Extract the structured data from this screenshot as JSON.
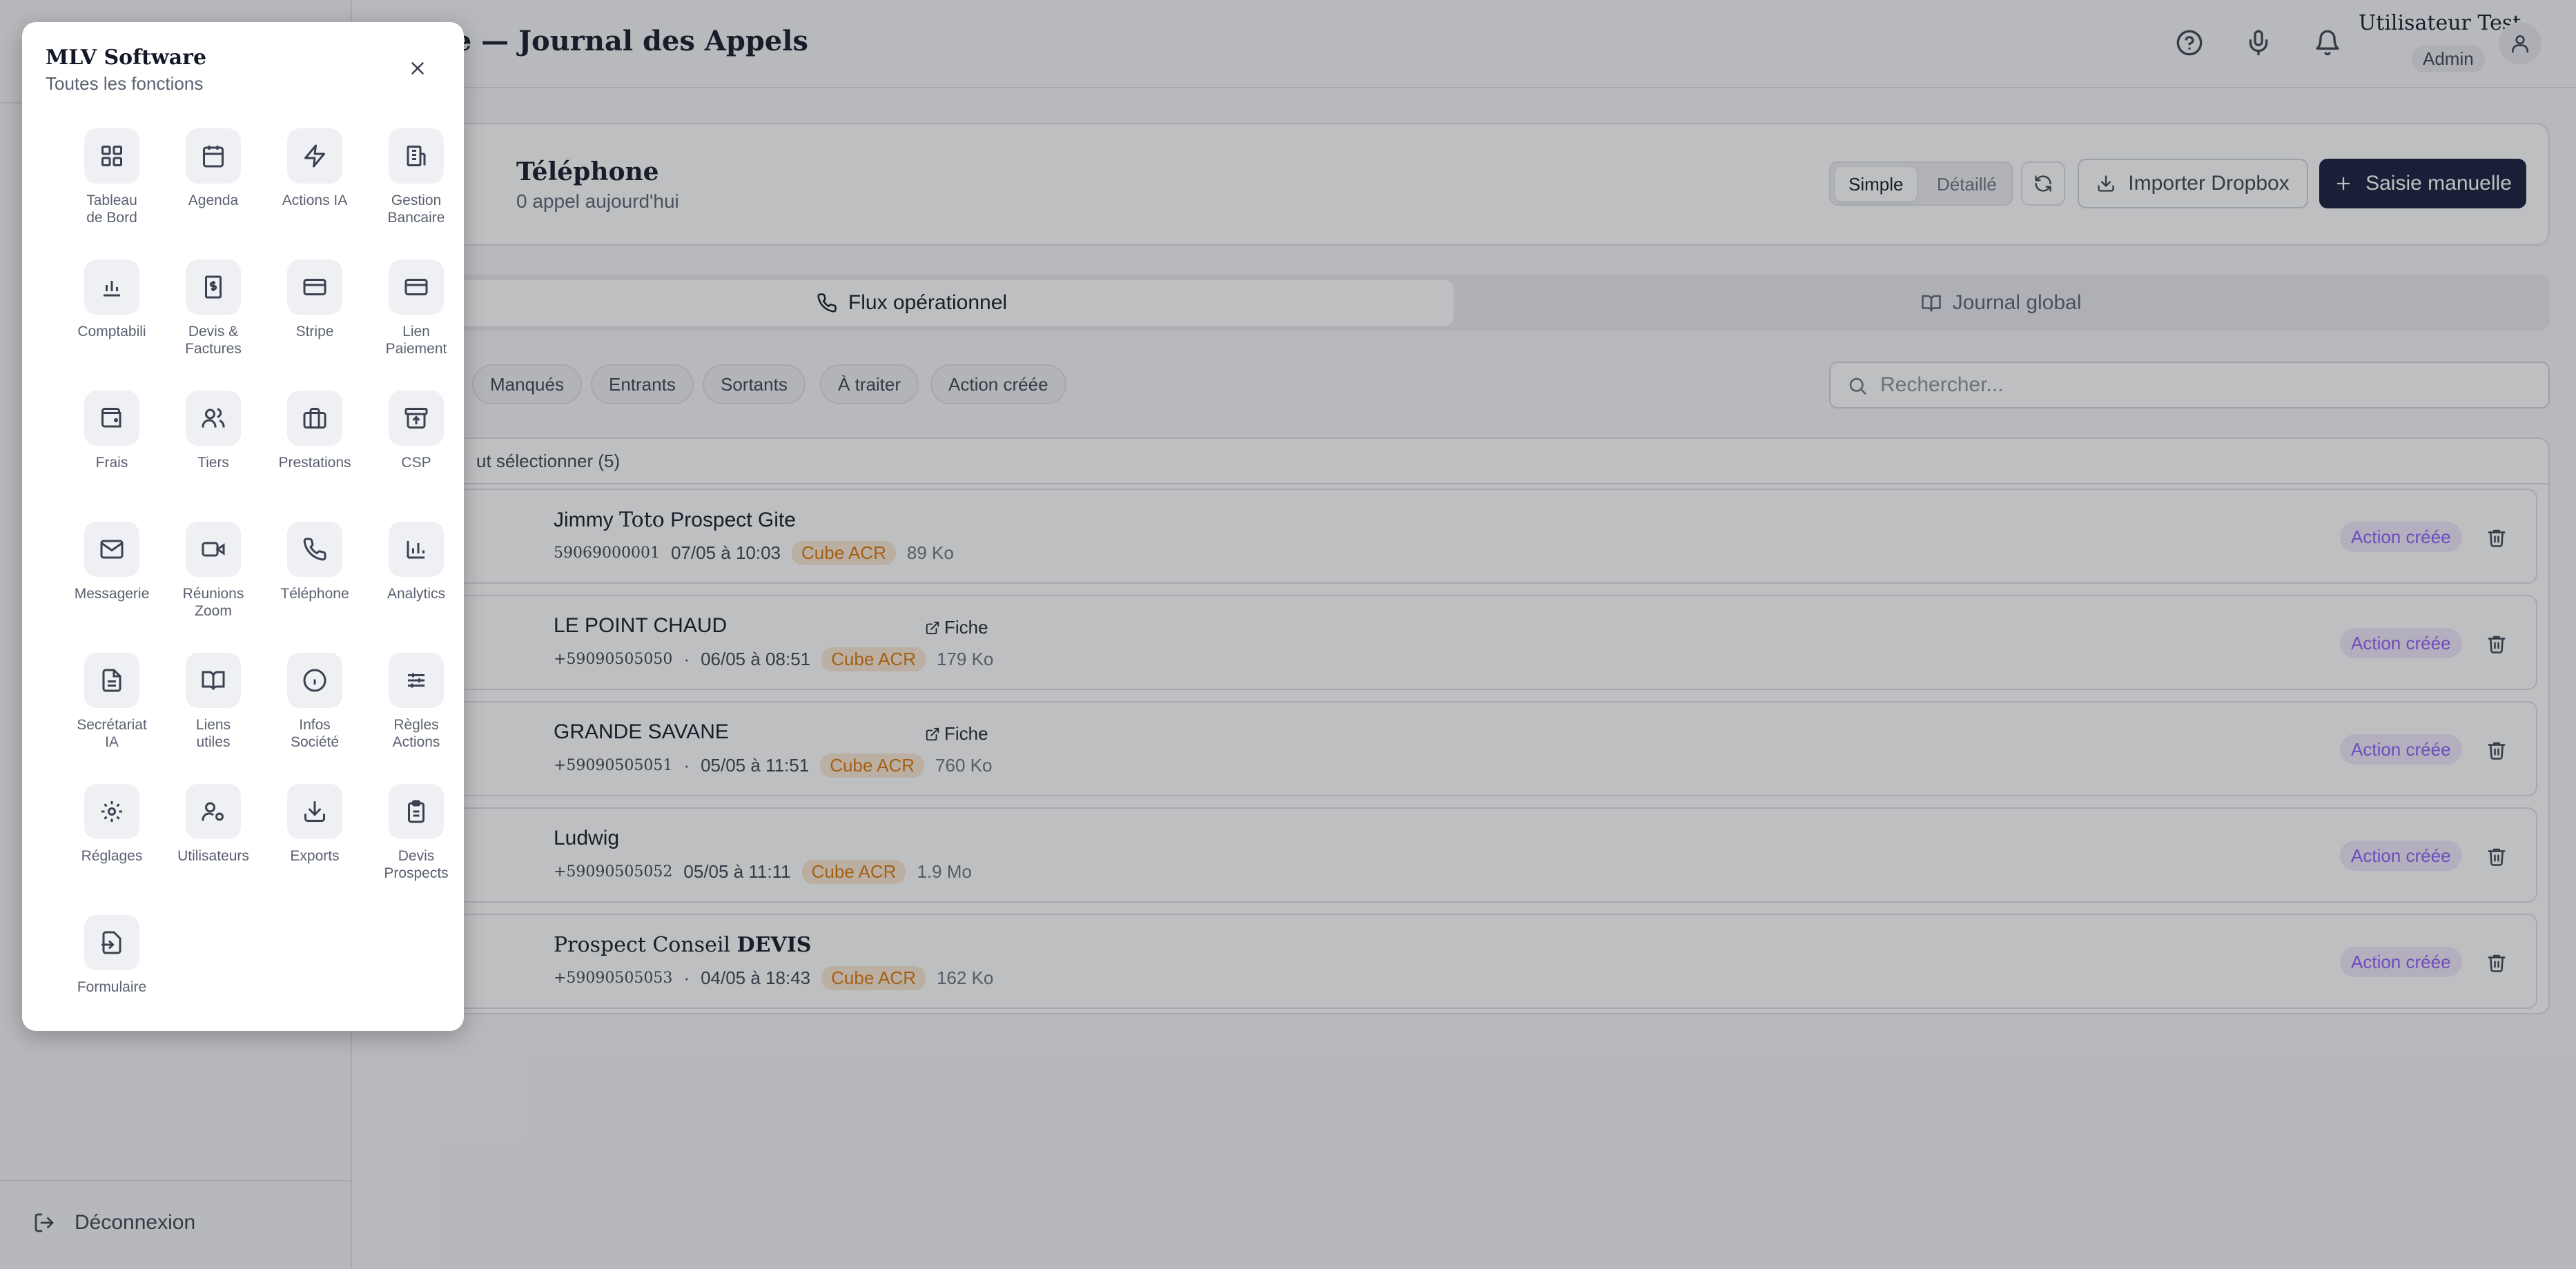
{
  "sidebar": {
    "logout_label": "Déconnexion"
  },
  "header": {
    "title": "one — Journal des Appels",
    "user_name": "Utilisateur Test",
    "user_role": "Admin"
  },
  "card": {
    "title": "Téléphone",
    "subtitle": "0 appel aujourd'hui",
    "view_simple": "Simple",
    "view_detailed": "Détaillé",
    "import_label": "Importer Dropbox",
    "manual_label": "Saisie manuelle"
  },
  "tabs": [
    {
      "label": "Flux opérationnel",
      "active": true
    },
    {
      "label": "Journal global",
      "active": false
    }
  ],
  "filters": [
    "Manqués",
    "Entrants",
    "Sortants",
    "À traiter",
    "Action créée"
  ],
  "search": {
    "placeholder": "Rechercher..."
  },
  "select_all": "ut sélectionner (5)",
  "calls": [
    {
      "name_a": "Jimmy",
      "name_b": "Toto",
      "name_c": "Prospect Gite",
      "number": "59069000001",
      "sep": "",
      "date": "07/05 à 10:03",
      "tag": "Cube ACR",
      "size": "89 Ko",
      "fiche": "",
      "status": "Action créée",
      "direction": "out"
    },
    {
      "name_a": "LE POINT CHAUD",
      "name_b": "",
      "name_c": "",
      "number": "+59090505050",
      "sep": "·",
      "date": "06/05 à 08:51",
      "tag": "Cube ACR",
      "size": "179 Ko",
      "fiche": "Fiche",
      "status": "Action créée",
      "direction": "in"
    },
    {
      "name_a": "GRANDE SAVANE",
      "name_b": "",
      "name_c": "",
      "number": "+59090505051",
      "sep": "·",
      "date": "05/05 à 11:51",
      "tag": "Cube ACR",
      "size": "760 Ko",
      "fiche": "Fiche",
      "status": "Action créée",
      "direction": "out"
    },
    {
      "name_a": "Ludwig",
      "name_b": "",
      "name_c": "",
      "number": "+59090505052",
      "sep": "",
      "date": "05/05 à 11:11",
      "tag": "Cube ACR",
      "size": "1.9 Mo",
      "fiche": "",
      "status": "Action créée",
      "direction": "in"
    },
    {
      "name_a": "",
      "name_b": "Prospect Conseil",
      "name_c": "DEVIS",
      "number": "+59090505053",
      "sep": "·",
      "date": "04/05 à 18:43",
      "tag": "Cube ACR",
      "size": "162 Ko",
      "fiche": "",
      "status": "Action créée",
      "direction": "out"
    }
  ],
  "panel": {
    "title": "MLV Software",
    "subtitle": "Toutes les fonctions",
    "items": [
      {
        "label": "Tableau\nde Bord",
        "icon": "dashboard-icon"
      },
      {
        "label": "Agenda",
        "icon": "calendar-icon"
      },
      {
        "label": "Actions IA",
        "icon": "lightning-icon"
      },
      {
        "label": "Gestion\nBancaire",
        "icon": "bank-icon"
      },
      {
        "label": "Comptabili",
        "icon": "bar-chart-icon"
      },
      {
        "label": "Devis &\nFactures",
        "icon": "invoice-icon"
      },
      {
        "label": "Stripe",
        "icon": "credit-card-icon"
      },
      {
        "label": "Lien\nPaiement",
        "icon": "payment-link-icon"
      },
      {
        "label": "Frais",
        "icon": "wallet-icon"
      },
      {
        "label": "Tiers",
        "icon": "users-icon"
      },
      {
        "label": "Prestations",
        "icon": "briefcase-icon"
      },
      {
        "label": "CSP",
        "icon": "archive-icon"
      },
      {
        "label": "Messagerie",
        "icon": "mail-icon"
      },
      {
        "label": "Réunions\nZoom",
        "icon": "video-icon"
      },
      {
        "label": "Téléphone",
        "icon": "phone-icon"
      },
      {
        "label": "Analytics",
        "icon": "analytics-icon"
      },
      {
        "label": "Secrétariat\nIA",
        "icon": "document-icon"
      },
      {
        "label": "Liens\nutiles",
        "icon": "book-icon"
      },
      {
        "label": "Infos\nSociété",
        "icon": "info-icon"
      },
      {
        "label": "Règles\nActions",
        "icon": "sliders-icon"
      },
      {
        "label": "Réglages",
        "icon": "gear-icon"
      },
      {
        "label": "Utilisateurs",
        "icon": "user-gear-icon"
      },
      {
        "label": "Exports",
        "icon": "download-icon"
      },
      {
        "label": "Devis\nProspects",
        "icon": "clipboard-icon"
      },
      {
        "label": "Formulaire",
        "icon": "form-import-icon"
      }
    ]
  },
  "colors": {
    "primary": "#121a3a",
    "cube_tag": "#d97706",
    "action_badge": "#8b5cf6",
    "incoming": "#2e9b57",
    "outgoing": "#3f62c0"
  }
}
